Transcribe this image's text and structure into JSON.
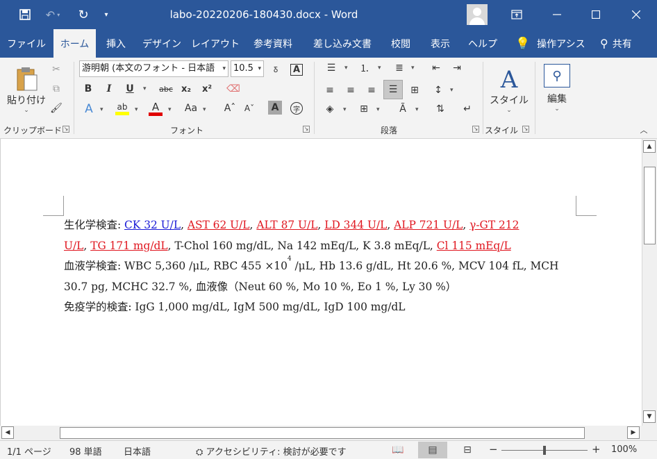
{
  "window": {
    "title": "labo-20220206-180430.docx  -  Word",
    "quick_access": {
      "save_icon": "save-icon",
      "undo_icon": "undo-icon",
      "redo_icon": "redo-icon",
      "customize_icon": "customize-qat-icon"
    },
    "controls": {
      "ribbon_display_icon": "ribbon-display-icon",
      "minimize_icon": "minimize-icon",
      "maximize_icon": "maximize-icon",
      "close_icon": "close-icon"
    }
  },
  "tabs": [
    {
      "label": "ファイル"
    },
    {
      "label": "ホーム",
      "active": true
    },
    {
      "label": "挿入"
    },
    {
      "label": "デザイン"
    },
    {
      "label": "レイアウト"
    },
    {
      "label": "参考資料"
    },
    {
      "label": "差し込み文書"
    },
    {
      "label": "校閲"
    },
    {
      "label": "表示"
    },
    {
      "label": "ヘルプ"
    }
  ],
  "tell_me": "操作アシス",
  "share": "共有",
  "ribbon": {
    "clipboard": {
      "paste_label": "貼り付け",
      "group_label": "クリップボード"
    },
    "font": {
      "font_name": "游明朝 (本文のフォント - 日本語",
      "font_size": "10.5",
      "group_label": "フォント",
      "bold": "B",
      "italic": "I",
      "underline": "U",
      "strikethrough": "abc",
      "subscript": "x₂",
      "superscript": "x²",
      "font_color_letter": "A",
      "highlight_color": "#ffff00",
      "font_color": "#e00000",
      "change_case": "Aa"
    },
    "paragraph": {
      "group_label": "段落"
    },
    "styles": {
      "label": "スタイル",
      "group_label": "スタイル"
    },
    "editing": {
      "label": "編集"
    }
  },
  "document": {
    "lines": [
      [
        {
          "text": "生化学検査: ",
          "style": "normal"
        },
        {
          "text": "CK 32 U/L",
          "style": "blue"
        },
        {
          "text": ", ",
          "style": "normal"
        },
        {
          "text": "AST 62 U/L",
          "style": "red"
        },
        {
          "text": ", ",
          "style": "normal"
        },
        {
          "text": "ALT 87 U/L",
          "style": "red"
        },
        {
          "text": ", ",
          "style": "normal"
        },
        {
          "text": "LD 344 U/L",
          "style": "red"
        },
        {
          "text": ", ",
          "style": "normal"
        },
        {
          "text": "ALP 721 U/L",
          "style": "red"
        },
        {
          "text": ",  ",
          "style": "normal"
        },
        {
          "text": "γ-GT 212",
          "style": "red"
        }
      ],
      [
        {
          "text": "U/L",
          "style": "red"
        },
        {
          "text": ", ",
          "style": "normal"
        },
        {
          "text": "TG 171 mg/dL",
          "style": "red"
        },
        {
          "text": ", T-Chol 160 mg/dL, Na 142 mEq/L, K 3.8 mEq/L, ",
          "style": "normal"
        },
        {
          "text": "Cl 115 mEq/L",
          "style": "red"
        }
      ],
      [
        {
          "text": "血液学検査: WBC 5,360 /μL, RBC 455 ×10",
          "style": "normal"
        },
        {
          "text": "4",
          "style": "sup"
        },
        {
          "text": " /μL, Hb 13.6 g/dL, Ht 20.6 %, MCV 104 fL, MCH",
          "style": "normal"
        }
      ],
      [
        {
          "text": "30.7 pg, MCHC 32.7 %,  血液像（Neut 60 %, Mo 10 %, Eo 1 %, Ly 30 %）",
          "style": "normal"
        }
      ],
      [
        {
          "text": "免疫学的検査: IgG 1,000 mg/dL, IgM 500 mg/dL, IgD 100 mg/dL",
          "style": "normal"
        }
      ]
    ]
  },
  "statusbar": {
    "page": "1/1 ページ",
    "words": "98 単語",
    "language": "日本語",
    "accessibility": "アクセシビリティ: 検討が必要です",
    "zoom_minus": "−",
    "zoom_plus": "+",
    "zoom_level": "100%",
    "zoom_fraction": 0.5
  }
}
